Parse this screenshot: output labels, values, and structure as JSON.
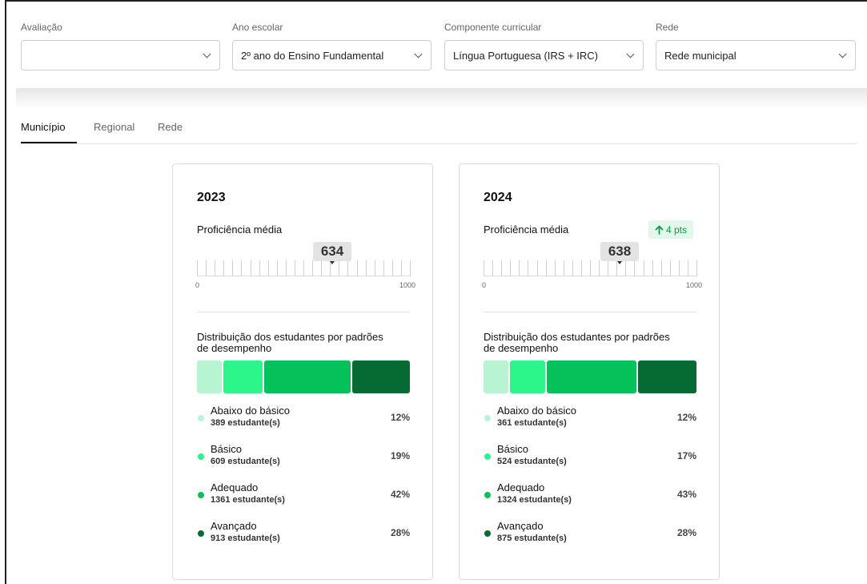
{
  "filters": [
    {
      "label": "Avaliação",
      "value": ""
    },
    {
      "label": "Ano escolar",
      "value": "2º ano do Ensino Fundamental"
    },
    {
      "label": "Componente curricular",
      "value": "Língua Portuguesa (IRS + IRC)"
    },
    {
      "label": "Rede",
      "value": "Rede municipal"
    }
  ],
  "tabs": [
    {
      "label": "Município",
      "active": true
    },
    {
      "label": "Regional",
      "active": false
    },
    {
      "label": "Rede",
      "active": false
    }
  ],
  "colors": {
    "abaixo": "#b7f5d2",
    "basico": "#2cf58a",
    "adequado": "#04c159",
    "avancado": "#066b32",
    "badge_bg": "#e3f8ea",
    "badge_text": "#0a9a45"
  },
  "cards": [
    {
      "year": "2023",
      "proficiency_label": "Proficiência média",
      "proficiency": 634,
      "scale_min": "0",
      "scale_max": "1000",
      "delta": null,
      "distribution_title": "Distribuição dos estudantes por padrões de desempenho",
      "levels": [
        {
          "name": "Abaixo do básico",
          "count": "389 estudante(s)",
          "pct": "12%",
          "value": 12,
          "color_key": "abaixo"
        },
        {
          "name": "Básico",
          "count": "609 estudante(s)",
          "pct": "19%",
          "value": 19,
          "color_key": "basico"
        },
        {
          "name": "Adequado",
          "count": "1361 estudante(s)",
          "pct": "42%",
          "value": 42,
          "color_key": "adequado"
        },
        {
          "name": "Avançado",
          "count": "913 estudante(s)",
          "pct": "28%",
          "value": 28,
          "color_key": "avancado"
        }
      ]
    },
    {
      "year": "2024",
      "proficiency_label": "Proficiência média",
      "proficiency": 638,
      "scale_min": "0",
      "scale_max": "1000",
      "delta": {
        "icon": "arrow-up-icon",
        "text": "4 pts"
      },
      "distribution_title": "Distribuição dos estudantes por padrões de desempenho",
      "levels": [
        {
          "name": "Abaixo do básico",
          "count": "361 estudante(s)",
          "pct": "12%",
          "value": 12,
          "color_key": "abaixo"
        },
        {
          "name": "Básico",
          "count": "524 estudante(s)",
          "pct": "17%",
          "value": 17,
          "color_key": "basico"
        },
        {
          "name": "Adequado",
          "count": "1324 estudante(s)",
          "pct": "43%",
          "value": 43,
          "color_key": "adequado"
        },
        {
          "name": "Avançado",
          "count": "875 estudante(s)",
          "pct": "28%",
          "value": 28,
          "color_key": "avancado"
        }
      ]
    }
  ]
}
